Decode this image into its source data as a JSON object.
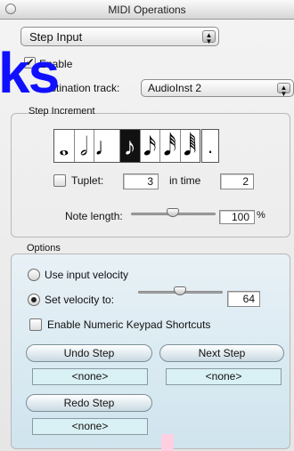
{
  "window": {
    "title": "MIDI Operations"
  },
  "mode_popup": {
    "value": "Step Input"
  },
  "overlay_text": "ks",
  "enable": {
    "label": "Enable",
    "checked": true,
    "check_glyph": "✔"
  },
  "destination": {
    "label": "stination track:",
    "value": "AudioInst  2"
  },
  "step_increment": {
    "title": "Step Increment",
    "note_buttons": [
      {
        "name": "whole-note-icon",
        "glyph": "𝅝"
      },
      {
        "name": "half-note-icon",
        "glyph": "𝅗𝅥"
      },
      {
        "name": "quarter-note-icon",
        "glyph": "♩"
      },
      {
        "name": "eighth-note-icon",
        "glyph": "♪",
        "selected": true
      },
      {
        "name": "sixteenth-note-icon",
        "glyph": "𝅘𝅥𝅯"
      },
      {
        "name": "thirty-second-note-icon",
        "glyph": "𝅘𝅥𝅰"
      },
      {
        "name": "sixty-fourth-note-icon",
        "glyph": "𝅘𝅥𝅱"
      }
    ],
    "dot_glyph": ".",
    "tuplet": {
      "label": "Tuplet:",
      "checked": false,
      "value": "3",
      "in_time_label": "in time",
      "in_time_value": "2"
    },
    "note_length": {
      "label": "Note length:",
      "value": "100",
      "unit": "%"
    }
  },
  "options": {
    "title": "Options",
    "use_input_velocity": {
      "label": "Use input velocity",
      "selected": false
    },
    "set_velocity": {
      "label": "Set velocity to:",
      "selected": true,
      "value": "64"
    },
    "numeric_keypad": {
      "label": "Enable Numeric Keypad Shortcuts",
      "checked": false
    },
    "undo_step": {
      "label": "Undo Step",
      "key": "<none>"
    },
    "next_step": {
      "label": "Next Step",
      "key": "<none>"
    },
    "redo_step": {
      "label": "Redo Step",
      "key": "<none>"
    }
  },
  "icons": {
    "close": "close-icon",
    "popup_arrows": "▲▼"
  }
}
